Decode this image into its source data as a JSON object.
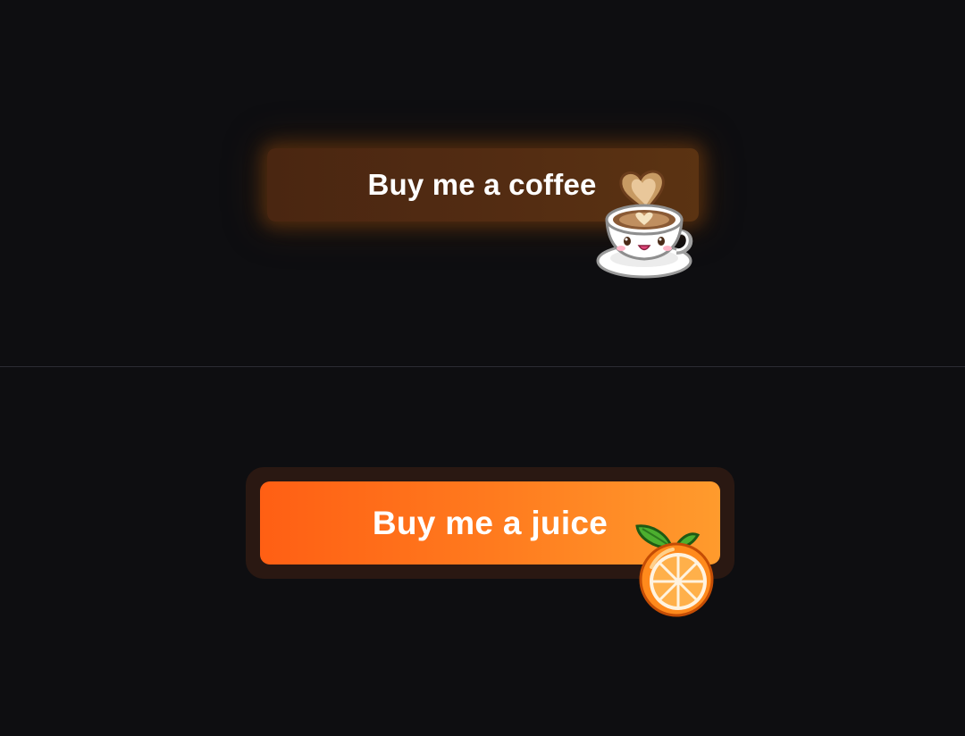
{
  "buttons": {
    "coffee": {
      "label": "Buy me a coffee",
      "icon": "coffee-cup-icon"
    },
    "juice": {
      "label": "Buy me a juice",
      "icon": "orange-icon"
    }
  },
  "colors": {
    "background": "#0e0e11",
    "coffee_button": "#532c12",
    "juice_button_start": "#ff5f14",
    "juice_button_end": "#ff9b2d",
    "label_text": "#ffffff"
  }
}
